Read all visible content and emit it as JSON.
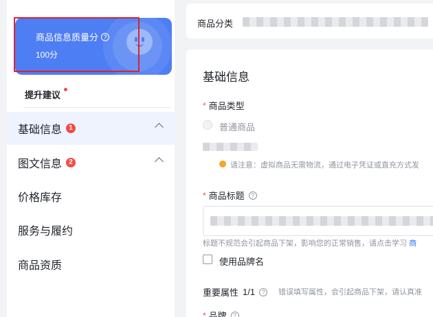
{
  "sidebar": {
    "score_card": {
      "title": "商品信息质量分",
      "value": "100分"
    },
    "suggest_label": "提升建议",
    "items": [
      {
        "label": "基础信息",
        "badge": "1",
        "expanded": true,
        "active": true
      },
      {
        "label": "图文信息",
        "badge": "2",
        "expanded": true,
        "active": false
      },
      {
        "label": "价格库存"
      },
      {
        "label": "服务与履约"
      },
      {
        "label": "商品资质"
      }
    ]
  },
  "topbar": {
    "label": "商品分类"
  },
  "main": {
    "section_title": "基础信息",
    "product_type": {
      "label": "商品类型",
      "option": "普通商品",
      "tip": "请注意：虚拟商品无需物流，通过电子凭证或直充方式发"
    },
    "product_title": {
      "label": "商品标题",
      "help": "标题不规范会引起商品下架，影响您的正常销售，请点击学习",
      "help_link": "商"
    },
    "brand_checkbox_label": "使用品牌名",
    "attributes": {
      "title": "重要属性",
      "count": "1/1",
      "tip": "错误填写属性，会引起商品下架，请认真准"
    },
    "brand": {
      "label": "品牌"
    }
  },
  "colors": {
    "accent": "#4e7ef3",
    "danger": "#f54a45",
    "link": "#3370ff"
  }
}
